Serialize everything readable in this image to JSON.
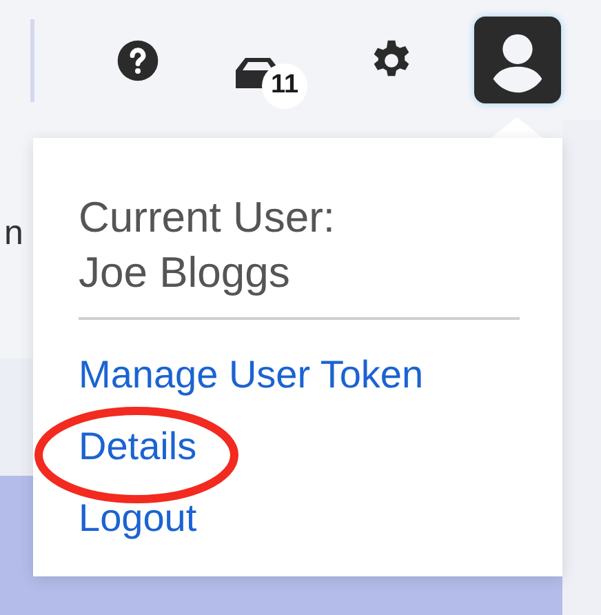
{
  "header": {
    "icons": [
      {
        "kind": "help"
      },
      {
        "kind": "inbox",
        "badge": "11"
      },
      {
        "kind": "settings"
      },
      {
        "kind": "user",
        "selected": true
      }
    ]
  },
  "background_text": "n",
  "user_menu": {
    "heading": "Current User:",
    "user_name": "Joe Bloggs",
    "items": [
      {
        "label": "Manage User Token",
        "circled": false
      },
      {
        "label": "Details",
        "circled": true
      },
      {
        "label": "Logout",
        "circled": false
      }
    ]
  }
}
